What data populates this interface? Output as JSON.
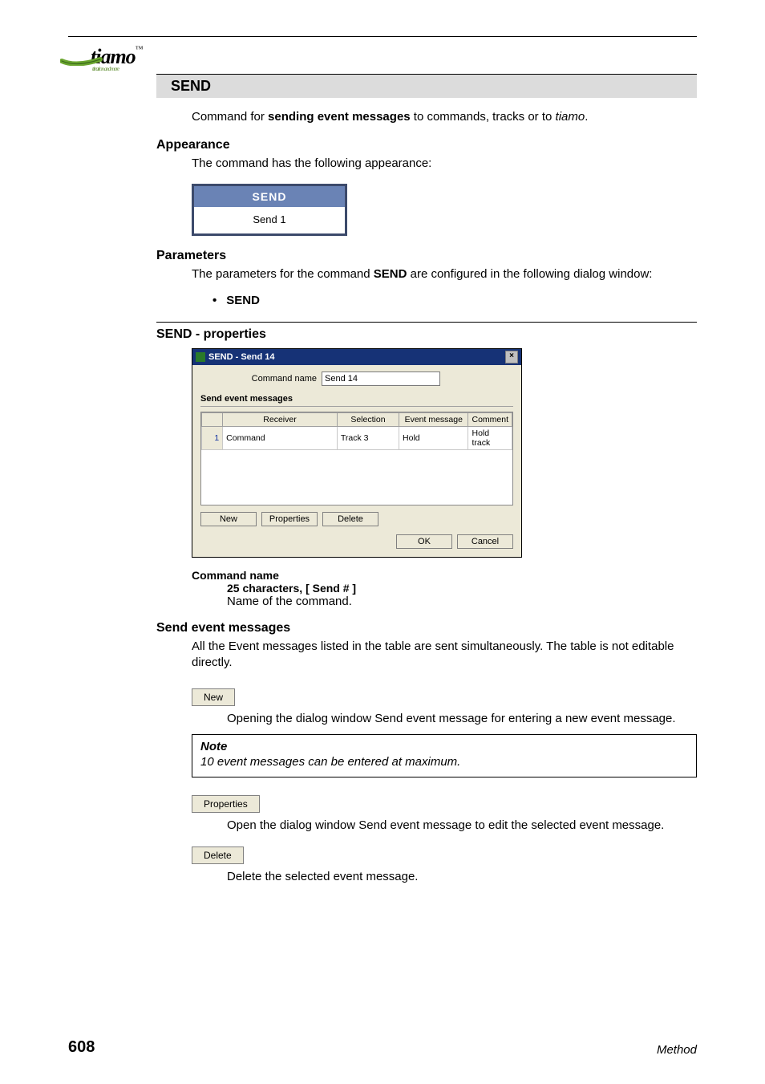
{
  "logo": {
    "text": "tiamo",
    "tm": "™",
    "sub": "titration and more"
  },
  "section_title": "SEND",
  "intro": {
    "pre": "Command for ",
    "bold": "sending event messages",
    "post": " to commands, tracks or to ",
    "ital": "tiamo",
    "end": "."
  },
  "appearance": {
    "heading": "Appearance",
    "text": "The command has the following appearance:",
    "block_head": "SEND",
    "block_body": "Send 1"
  },
  "parameters": {
    "heading": "Parameters",
    "pre": "The parameters for the command ",
    "bold": "SEND",
    "post": " are configured in the following dialog window:",
    "bullet": "SEND"
  },
  "props_heading": "SEND - properties",
  "dialog": {
    "title": "SEND - Send 14",
    "close": "×",
    "cmd_label": "Command name",
    "cmd_value": "Send 14",
    "group_label": "Send event messages",
    "headers": {
      "c0": "",
      "c1": "Receiver",
      "c2": "Selection",
      "c3": "Event message",
      "c4": "Comment"
    },
    "row": {
      "n": "1",
      "receiver": "Command",
      "selection": "Track 3",
      "event": "Hold",
      "comment": "Hold track"
    },
    "btn_new": "New",
    "btn_props": "Properties",
    "btn_delete": "Delete",
    "btn_ok": "OK",
    "btn_cancel": "Cancel"
  },
  "def": {
    "term": "Command name",
    "sub": "25 characters, [ Send # ]",
    "body": "Name of the command."
  },
  "sem": {
    "heading": "Send event messages",
    "text": "All the Event messages listed in the table are sent simultaneously. The table is not editable directly."
  },
  "btns": {
    "new": "New",
    "new_desc": "Opening the dialog window Send event message for entering a new event message.",
    "props": "Properties",
    "props_desc": "Open the dialog window Send event message to edit the selected event message.",
    "del": "Delete",
    "del_desc": "Delete the selected event message."
  },
  "note": {
    "head": "Note",
    "body": "10 event messages can be entered at maximum."
  },
  "footer": {
    "page": "608",
    "title": "Method"
  }
}
